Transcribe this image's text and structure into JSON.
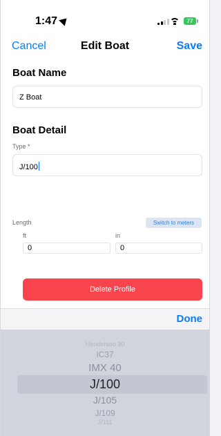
{
  "status_bar": {
    "time": "1:47",
    "battery": "77"
  },
  "nav": {
    "cancel": "Cancel",
    "title": "Edit Boat",
    "save": "Save"
  },
  "boat_name": {
    "heading": "Boat Name",
    "value": "Z Boat"
  },
  "boat_detail": {
    "heading": "Boat Detail",
    "type_label": "Type *",
    "type_value": "J/100"
  },
  "length": {
    "label": "Length",
    "switch_label": "Switch to meters",
    "ft_label": "ft",
    "ft_value": "0",
    "in_label": "in",
    "in_value": "0"
  },
  "delete_label": "Delete Profile",
  "toolbar": {
    "done": "Done"
  },
  "picker": {
    "items": [
      "Henderson 30",
      "IC37",
      "IMX 40",
      "J/100",
      "J/105",
      "J/109",
      "J/111"
    ],
    "selected": "J/100"
  },
  "colors": {
    "accent": "#0a7bff",
    "danger": "#f8444c",
    "battery": "#34c759"
  }
}
